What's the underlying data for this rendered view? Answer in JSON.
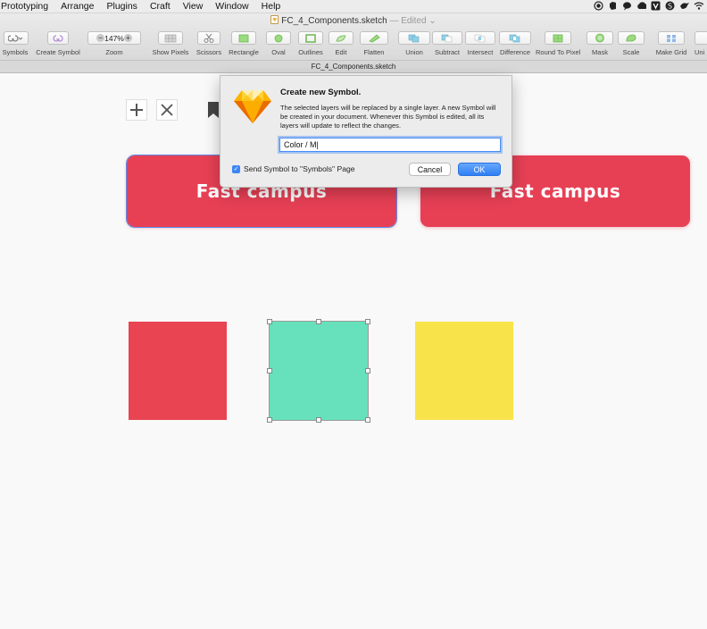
{
  "menubar": {
    "items": [
      "Prototyping",
      "Arrange",
      "Plugins",
      "Craft",
      "View",
      "Window",
      "Help"
    ],
    "status_icons": [
      "record-icon",
      "evernote-icon",
      "messages-icon",
      "creative-cloud-icon",
      "app-icon",
      "skype-icon",
      "bird-icon",
      "wifi-icon"
    ]
  },
  "window": {
    "title": "FC_4_Components.sketch",
    "edited": "— Edited"
  },
  "toolbar": {
    "symbols": "Symbols",
    "create_symbol": "Create Symbol",
    "zoom": "Zoom",
    "zoom_value": "147%",
    "zoom_minus": "−",
    "zoom_plus": "+",
    "show_pixels": "Show Pixels",
    "scissors": "Scissors",
    "rectangle": "Rectangle",
    "oval": "Oval",
    "outlines": "Outlines",
    "edit": "Edit",
    "flatten": "Flatten",
    "union": "Union",
    "subtract": "Subtract",
    "intersect": "Intersect",
    "difference": "Difference",
    "round_to_pixel": "Round To Pixel",
    "mask": "Mask",
    "scale": "Scale",
    "make_grid": "Make Grid",
    "truncated": "Uni"
  },
  "tabbar": {
    "label": "FC_4_Components.sketch"
  },
  "canvas": {
    "banner_text": "Fast campus",
    "banner_color": "#e74055",
    "square_colors": [
      "#e84452",
      "#66e1bc",
      "#f8e34b"
    ],
    "selection_color": "#5b8dec"
  },
  "dialog": {
    "title": "Create new Symbol.",
    "message": "The selected layers will be replaced by a single layer. A new Symbol will be created in your document. Whenever this Symbol is edited, all its layers will update to reflect the changes.",
    "input_value": "Color / M|",
    "checkbox_label": "Send Symbol to \"Symbols\" Page",
    "checkbox_checked": true,
    "cancel": "Cancel",
    "ok": "OK"
  }
}
